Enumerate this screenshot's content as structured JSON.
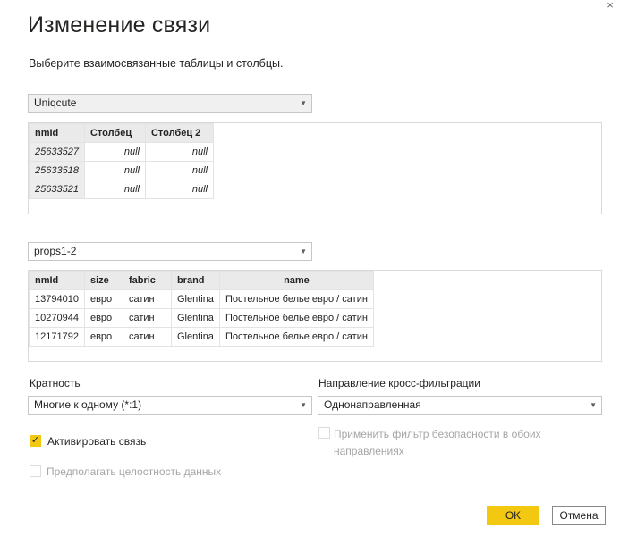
{
  "dialog": {
    "title": "Изменение связи",
    "subtitle": "Выберите взаимосвязанные таблицы и столбцы.",
    "close_glyph": "×"
  },
  "table1": {
    "selected": "Uniqcute",
    "columns": [
      "nmId",
      "Столбец",
      "Столбец 2"
    ],
    "rows": [
      [
        "25633527",
        "null",
        "null"
      ],
      [
        "25633518",
        "null",
        "null"
      ],
      [
        "25633521",
        "null",
        "null"
      ]
    ]
  },
  "table2": {
    "selected": "props1-2",
    "columns": [
      "nmId",
      "size",
      "fabric",
      "brand",
      "name"
    ],
    "rows": [
      [
        "13794010",
        "евро",
        "сатин",
        "Glentina",
        "Постельное белье евро / сатин"
      ],
      [
        "10270944",
        "евро",
        "сатин",
        "Glentina",
        "Постельное белье евро / сатин"
      ],
      [
        "12171792",
        "евро",
        "сатин",
        "Glentina",
        "Постельное белье евро / сатин"
      ]
    ]
  },
  "cardinality": {
    "label": "Кратность",
    "value": "Многие к одному (*:1)"
  },
  "crossfilter": {
    "label": "Направление кросс-фильтрации",
    "value": "Однонаправленная"
  },
  "options": {
    "activate": {
      "label": "Активировать связь",
      "checked": true
    },
    "security_filter": {
      "label_line1": "Применить фильтр безопасности в обоих",
      "label_line2": "направлениях",
      "checked": false,
      "disabled": true
    },
    "integrity": {
      "label": "Предполагать целостность данных",
      "checked": false,
      "disabled": true
    }
  },
  "buttons": {
    "ok": "OK",
    "cancel": "Отмена"
  },
  "colors": {
    "accent": "#f2c811",
    "header_bg": "#eaeaea",
    "disabled_text": "#a6a6a6"
  }
}
